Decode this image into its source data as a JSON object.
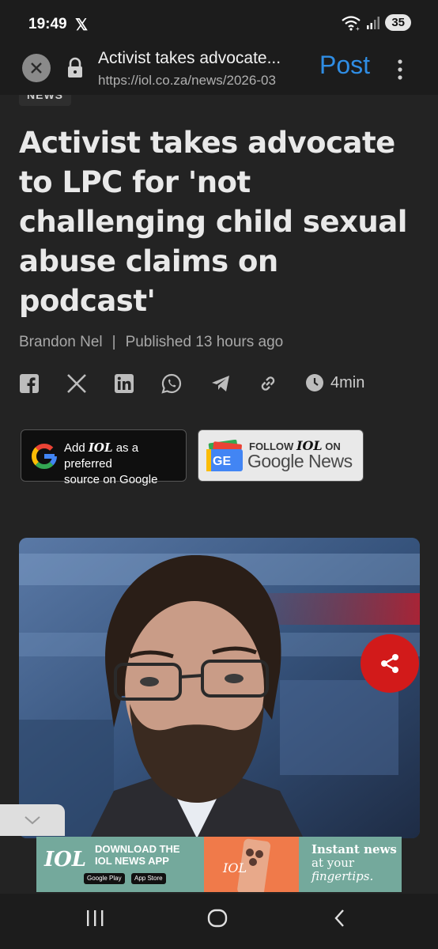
{
  "status": {
    "time": "19:49",
    "x_logo": "𝕏",
    "battery": "35"
  },
  "url_bar": {
    "title": "Activist takes advocate...",
    "url": "https://iol.co.za/news/2026-03",
    "post_label": "Post"
  },
  "article": {
    "tag": "NEWS",
    "headline": "Activist takes advocate to LPC for 'not challenging child sexual abuse claims on podcast'",
    "author": "Brandon Nel",
    "separator": "|",
    "published": "Published 13 hours ago",
    "read_time": "4min",
    "share_icons": [
      "facebook-icon",
      "x-icon",
      "linkedin-icon",
      "whatsapp-icon",
      "telegram-icon",
      "link-icon"
    ]
  },
  "preferred_source": {
    "line1_prefix": "Add",
    "brand": "IOL",
    "line1_suffix": "as a preferred",
    "line2": "source on Google"
  },
  "google_news": {
    "follow": "FOLLOW",
    "brand": "IOL",
    "on": "ON",
    "name": "Google News"
  },
  "ad": {
    "logo": "IOL",
    "download_line1": "DOWNLOAD THE",
    "download_line2": "IOL NEWS APP",
    "google_play": "Google Play",
    "app_store": "App Store",
    "phone_logo": "IOL",
    "tagline_line1": "Instant news",
    "tagline_line2": "at your",
    "tagline_line3": "fingertips."
  },
  "colors": {
    "accent_blue": "#2f8de4",
    "share_red": "#d21a1a",
    "background": "#232323"
  }
}
